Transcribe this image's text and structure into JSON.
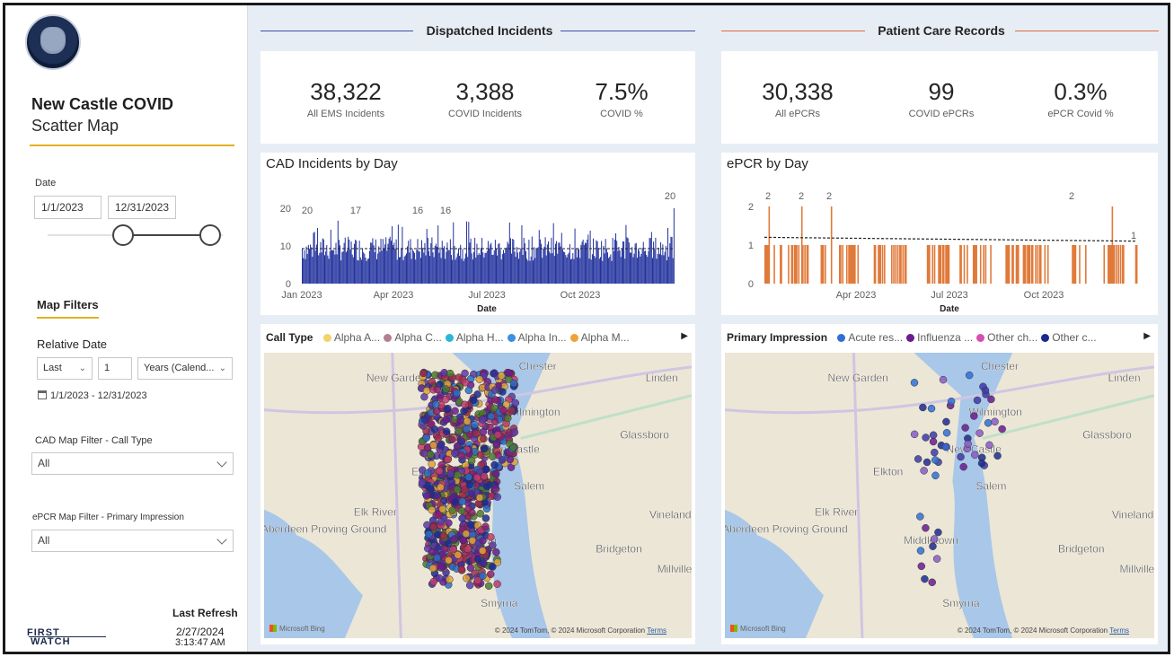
{
  "sidebar": {
    "title": "New Castle COVID",
    "subtitle": "Scatter Map",
    "date_label": "Date",
    "date_start": "1/1/2023",
    "date_end": "12/31/2023",
    "map_filters_label": "Map Filters",
    "relative_date_label": "Relative Date",
    "relative_mode": "Last",
    "relative_count": "1",
    "relative_unit": "Years (Calend...",
    "relative_range": "1/1/2023 - 12/31/2023",
    "cad_filter_label": "CAD Map Filter - Call Type",
    "cad_filter_value": "All",
    "epcr_filter_label": "ePCR Map Filter - Primary Impression",
    "epcr_filter_value": "All",
    "last_refresh_label": "Last Refresh",
    "last_refresh_date": "2/27/2024",
    "last_refresh_time": "3:13:47 AM",
    "vendor_logo": "FIRST WATCH"
  },
  "dispatched": {
    "heading": "Dispatched Incidents",
    "line_color": "#3b4ea8",
    "kpis": [
      {
        "value": "38,322",
        "label": "All EMS Incidents"
      },
      {
        "value": "3,388",
        "label": "COVID Incidents"
      },
      {
        "value": "7.5%",
        "label": "COVID %"
      }
    ],
    "chart_title": "CAD Incidents by Day",
    "legend_title": "Call Type",
    "legend": [
      {
        "label": "Alpha A...",
        "color": "#f2d36b"
      },
      {
        "label": "Alpha C...",
        "color": "#b57f93"
      },
      {
        "label": "Alpha H...",
        "color": "#2bb7d8"
      },
      {
        "label": "Alpha In...",
        "color": "#3d8fe0"
      },
      {
        "label": "Alpha M...",
        "color": "#f0a13a"
      }
    ]
  },
  "patient_care": {
    "heading": "Patient Care Records",
    "line_color": "#e06a3c",
    "kpis": [
      {
        "value": "30,338",
        "label": "All ePCRs"
      },
      {
        "value": "99",
        "label": "COVID ePCRs"
      },
      {
        "value": "0.3%",
        "label": "ePCR Covid %"
      }
    ],
    "chart_title": "ePCR by Day",
    "legend_title": "Primary Impression",
    "legend": [
      {
        "label": "Acute res...",
        "color": "#2f6fd6"
      },
      {
        "label": "Influenza ...",
        "color": "#6a1b8f"
      },
      {
        "label": "Other ch...",
        "color": "#d64fb0"
      },
      {
        "label": "Other c...",
        "color": "#1b2a8f"
      }
    ]
  },
  "map_labels": {
    "places": [
      "Chester",
      "New Garden",
      "Linden",
      "Glassboro",
      "Elkton",
      "Salem",
      "Elk River",
      "Aberdeen Proving Ground",
      "Vineland",
      "Bridgeton",
      "Millville",
      "Middletown",
      "Smyrna",
      "Wilmington",
      "New Castle"
    ],
    "attribution": "© 2024 TomTom, © 2024 Microsoft Corporation",
    "terms": "Terms",
    "bing": "Microsoft Bing"
  },
  "chart_data": [
    {
      "type": "bar",
      "title": "CAD Incidents by Day",
      "xlabel": "Date",
      "ylabel": "",
      "ylim": [
        0,
        20
      ],
      "yticks": [
        0,
        10,
        20
      ],
      "xticks": [
        "Jan 2023",
        "Apr 2023",
        "Jul 2023",
        "Oct 2023"
      ],
      "annotations": [
        20,
        17,
        16,
        16,
        20
      ],
      "series": [
        {
          "color": "#1f2f9c",
          "approx_mean": 9.3,
          "days": 365
        }
      ],
      "reference_line": "dashed average"
    },
    {
      "type": "bar",
      "title": "ePCR by Day",
      "xlabel": "Date",
      "ylabel": "",
      "ylim": [
        0,
        2
      ],
      "yticks": [
        0,
        1,
        2
      ],
      "xticks": [
        "Apr 2023",
        "Jul 2023",
        "Oct 2023"
      ],
      "annotations": [
        2,
        2,
        2,
        2,
        1
      ],
      "series": [
        {
          "color": "#e07a3a"
        }
      ],
      "trend_line": "dashed decreasing from 1.2 to 1.1"
    }
  ]
}
